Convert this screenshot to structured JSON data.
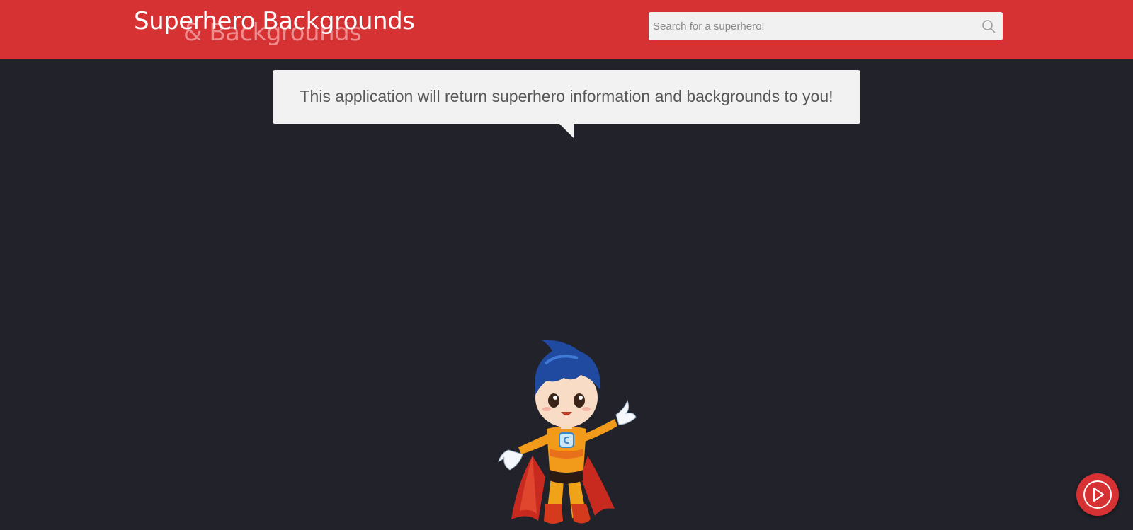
{
  "header": {
    "title": "Superhero Backgrounds",
    "title_shadow": "& Backgrounds",
    "search": {
      "placeholder": "Search for a superhero!",
      "value": ""
    }
  },
  "main": {
    "bubble_text": "This application will return superhero information and backgrounds to you!"
  },
  "colors": {
    "header_bg": "#d63234",
    "page_bg": "#21222a",
    "bubble_bg": "#f2f2f2"
  },
  "icons": {
    "search": "search-icon",
    "play": "play-icon",
    "mascot": "superhero-mascot"
  }
}
